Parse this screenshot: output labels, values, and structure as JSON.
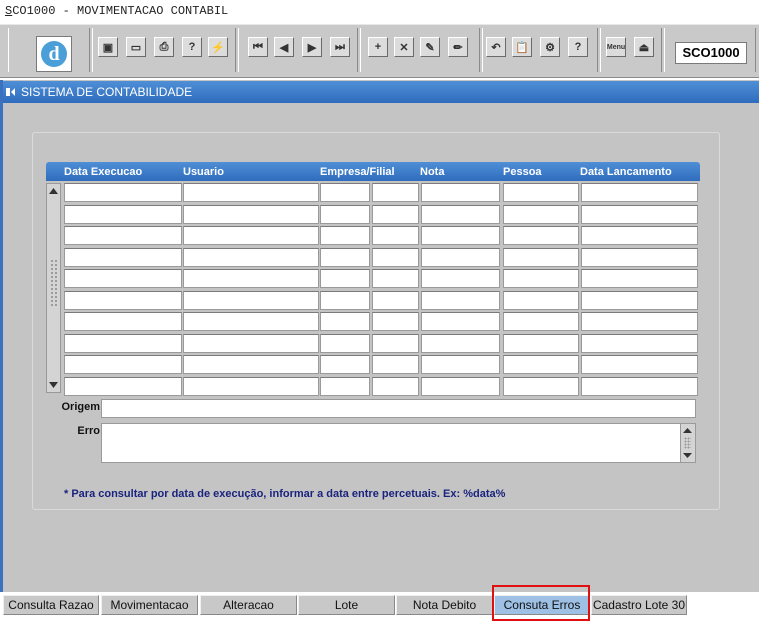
{
  "window": {
    "title_first_char": "S",
    "title_rest": "CO1000 - MOVIMENTACAO CONTABIL",
    "form_code": "SCO1000"
  },
  "toolbar": {
    "logo_letter": "d",
    "buttons": [
      {
        "name": "save-icon",
        "glyph": "▣"
      },
      {
        "name": "window-icon",
        "glyph": "▭"
      },
      {
        "name": "print-icon",
        "glyph": "⎙"
      },
      {
        "name": "query-help-icon",
        "glyph": "?"
      },
      {
        "name": "execute-query-icon",
        "glyph": "⚡"
      },
      {
        "name": "first-record-icon",
        "glyph": "⏮"
      },
      {
        "name": "previous-record-icon",
        "glyph": "◀"
      },
      {
        "name": "next-record-icon",
        "glyph": "▶"
      },
      {
        "name": "last-record-icon",
        "glyph": "⏭"
      },
      {
        "name": "insert-record-icon",
        "glyph": "+"
      },
      {
        "name": "delete-record-icon",
        "glyph": "✕"
      },
      {
        "name": "edit-record-icon",
        "glyph": "✎"
      },
      {
        "name": "clear-icon",
        "glyph": "✏"
      },
      {
        "name": "undo-icon",
        "glyph": "↶"
      },
      {
        "name": "clipboard-icon",
        "glyph": "📋"
      },
      {
        "name": "tools-icon",
        "glyph": "⚙"
      },
      {
        "name": "help-icon",
        "glyph": "?"
      },
      {
        "name": "menu-icon",
        "glyph": "Menu"
      },
      {
        "name": "exit-icon",
        "glyph": "⏏"
      }
    ]
  },
  "header": {
    "system_title": "SISTEMA DE CONTABILIDADE"
  },
  "grid": {
    "columns": [
      "Data Execucao",
      "Usuario",
      "Empresa/Filial",
      "Nota",
      "Pessoa",
      "Data Lancamento"
    ],
    "row_count": 10
  },
  "fields": {
    "origem_label": "Origem",
    "erro_label": "Erro",
    "origem_value": "",
    "erro_value": ""
  },
  "hint": "* Para consultar por data de execução, informar a data entre percetuais. Ex: %data%",
  "tabs": [
    {
      "label": "Consulta Razao",
      "active": false
    },
    {
      "label": "Movimentacao",
      "active": false
    },
    {
      "label": "Alteracao",
      "active": false
    },
    {
      "label": "Lote",
      "active": false
    },
    {
      "label": "Nota Debito",
      "active": false
    },
    {
      "label": "Consuta Erros",
      "active": true
    },
    {
      "label": "Cadastro Lote 30",
      "active": false
    }
  ],
  "colors": {
    "accent": "#2f6cbd",
    "panel": "#c4c4c4",
    "hint": "#1a237e",
    "highlight": "#e01010"
  }
}
